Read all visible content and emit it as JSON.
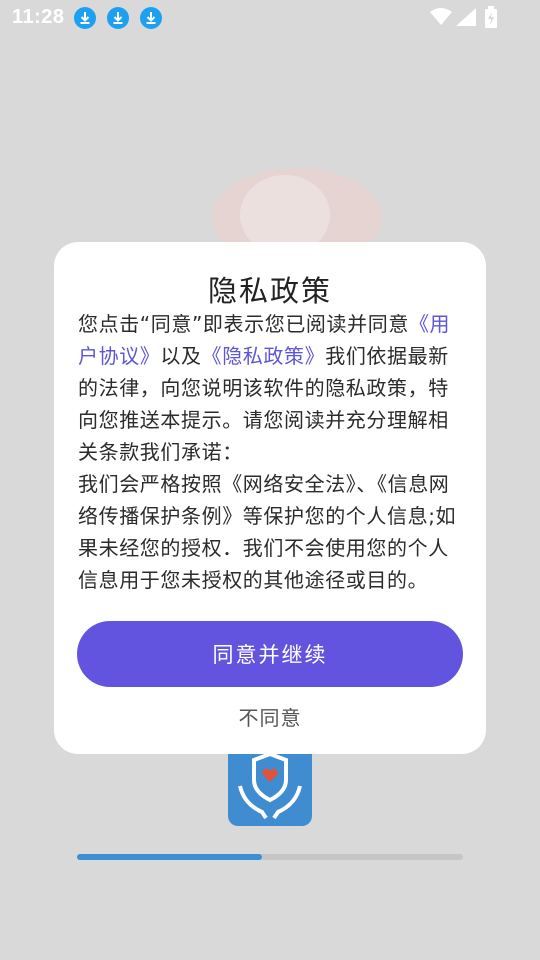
{
  "status_bar": {
    "time": "11:28",
    "download_icons": [
      "download-icon",
      "download-icon",
      "download-icon"
    ],
    "system_icons": [
      "wifi-icon",
      "signal-icon",
      "battery-charging-icon"
    ]
  },
  "background": {
    "progress": 0.48,
    "colors": {
      "progress_fill": "#3d8ed2",
      "logo": "#3f8dd0"
    }
  },
  "dialog": {
    "title": "隐私政策",
    "body": {
      "intro_prefix": "您点击“同意”即表示您已阅读并同意",
      "user_agreement_link": "《用户协议》",
      "connector": "以及",
      "privacy_policy_link": "《隐私政策》",
      "intro_suffix": "我们依据最新的法律，向您说明该软件的隐私政策，特向您推送本提示。请您阅读并充分理解相关条款我们承诺：",
      "commitment": "我们会严格按照《网络安全法》、《信息网络传播保护条例》等保护您的个人信息;如果未经您的授权．我们不会使用您的个人信息用于您未授权的其他途径或目的。"
    },
    "agree_button": "同意并继续",
    "disagree_button": "不同意",
    "colors": {
      "primary": "#6354e0",
      "link": "#5d56d9"
    }
  }
}
